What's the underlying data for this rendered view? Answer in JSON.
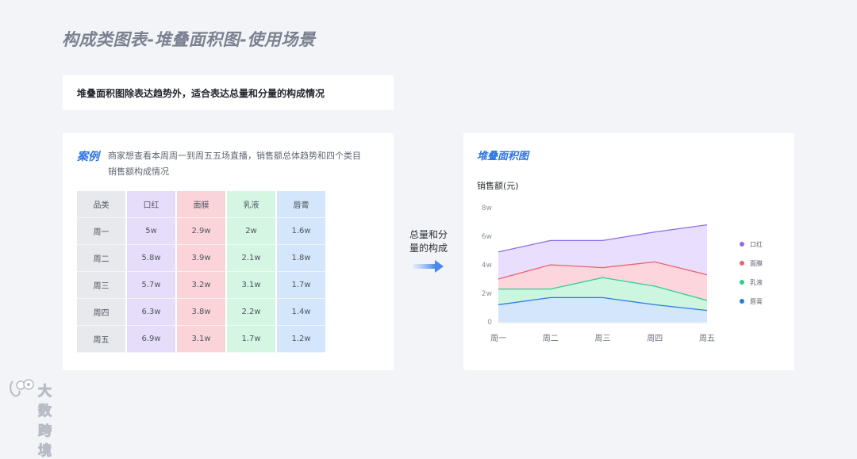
{
  "page": {
    "title": "构成类图表-堆叠面积图-使用场景",
    "subtitle": "堆叠面积图除表达趋势外，适合表达总量和分量的构成情况"
  },
  "case": {
    "label": "案例",
    "description": "商家想查看本周周一到周五五场直播，销售额总体趋势和四个类目销售额构成情况",
    "table": {
      "headers": [
        "品类",
        "口红",
        "面膜",
        "乳液",
        "唇膏"
      ],
      "rows": [
        [
          "周一",
          "5w",
          "2.9w",
          "2w",
          "1.6w"
        ],
        [
          "周二",
          "5.8w",
          "3.9w",
          "2.1w",
          "1.8w"
        ],
        [
          "周三",
          "5.7w",
          "3.2w",
          "3.1w",
          "1.7w"
        ],
        [
          "周四",
          "6.3w",
          "3.8w",
          "2.2w",
          "1.4w"
        ],
        [
          "周五",
          "6.9w",
          "3.1w",
          "1.7w",
          "1.2w"
        ]
      ]
    }
  },
  "arrow_text": "总量和分量的构成",
  "watermark": "大数跨境",
  "colors": {
    "accent": "#2d74e6",
    "口红": "#8e6ce8",
    "面膜": "#e8636c",
    "乳液": "#2fcf8a",
    "唇膏": "#2a7ae2"
  },
  "chart_data": {
    "type": "area",
    "stacked": true,
    "title": "堆叠面积图",
    "ylabel": "销售额(元)",
    "categories": [
      "周一",
      "周二",
      "周三",
      "周四",
      "周五"
    ],
    "y_ticks": [
      "0",
      "2w",
      "4w",
      "6w",
      "8w"
    ],
    "ylim": [
      0,
      8
    ],
    "legend_position": "right",
    "grid": false,
    "series": [
      {
        "name": "口红",
        "color": "#8e6ce8",
        "fill": "#e9defd",
        "values": [
          4.9,
          5.7,
          5.7,
          6.3,
          6.8
        ]
      },
      {
        "name": "面膜",
        "color": "#e8636c",
        "fill": "#fdd6dd",
        "values": [
          3.0,
          4.0,
          3.8,
          4.2,
          3.3
        ]
      },
      {
        "name": "乳液",
        "color": "#2fcf8a",
        "fill": "#cdf6e1",
        "values": [
          2.3,
          2.3,
          3.1,
          2.5,
          1.5
        ]
      },
      {
        "name": "唇膏",
        "color": "#2a7ae2",
        "fill": "#d3e6fb",
        "values": [
          1.2,
          1.7,
          1.7,
          1.2,
          0.8
        ]
      }
    ]
  }
}
